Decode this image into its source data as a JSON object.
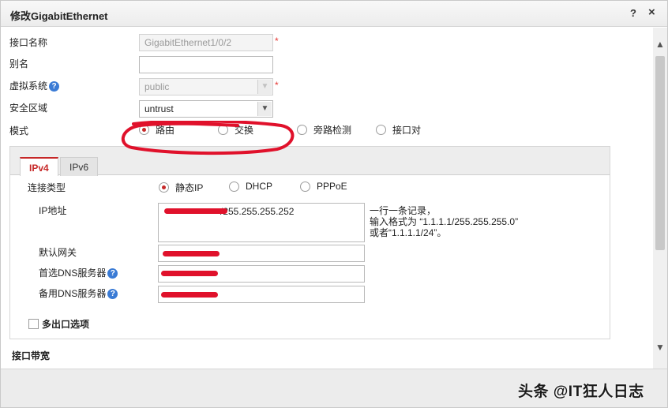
{
  "dialog": {
    "title": "修改GigabitEthernet",
    "help_label": "?",
    "close_label": "×"
  },
  "form": {
    "interface_name": {
      "label": "接口名称",
      "value": "GigabitEthernet1/0/2",
      "required_mark": "*"
    },
    "alias": {
      "label": "别名",
      "value": ""
    },
    "virtual_system": {
      "label": "虚拟系统",
      "help": "?",
      "value": "public",
      "required_mark": "*"
    },
    "security_zone": {
      "label": "安全区域",
      "value": "untrust"
    },
    "mode": {
      "label": "模式",
      "options": [
        "路由",
        "交换",
        "旁路检测",
        "接口对"
      ],
      "selected": "路由"
    }
  },
  "ip_section": {
    "tabs": [
      "IPv4",
      "IPv6"
    ],
    "active_tab": "IPv4",
    "connection_type": {
      "label": "连接类型",
      "options": [
        "静态IP",
        "DHCP",
        "PPPoE"
      ],
      "selected": "静态IP"
    },
    "ip_address": {
      "label": "IP地址",
      "value_visible": "/255.255.255.252"
    },
    "hint": {
      "line1": "一行一条记录，",
      "line2": "输入格式为 “1.1.1.1/255.255.255.0”",
      "line3": "或者“1.1.1.1/24”。"
    },
    "default_gateway": {
      "label": "默认网关"
    },
    "primary_dns": {
      "label": "首选DNS服务器",
      "help": "?"
    },
    "secondary_dns": {
      "label": "备用DNS服务器",
      "help": "?"
    },
    "multi_exit": {
      "label": "多出口选项",
      "checked": false
    }
  },
  "bandwidth": {
    "title": "接口带宽"
  },
  "scrollbar": {
    "up": "▲",
    "down": "▼"
  },
  "watermark": {
    "text": "头条 @IT狂人日志"
  },
  "colors": {
    "accent": "#c62828",
    "redaction": "#e0112b",
    "help_icon": "#3a7bd5"
  }
}
